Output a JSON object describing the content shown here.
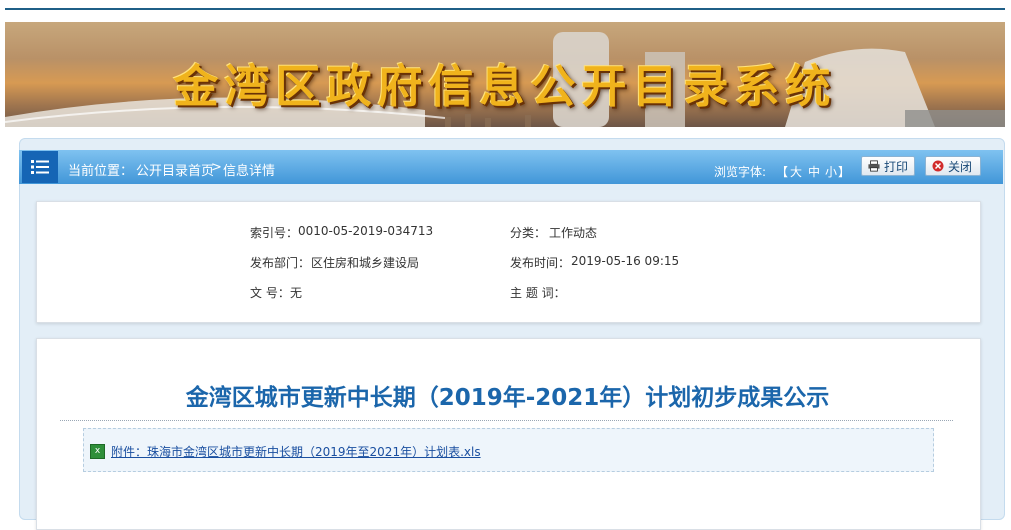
{
  "banner": {
    "title": "金湾区政府信息公开目录系统"
  },
  "nav": {
    "location_label": "当前位置：",
    "breadcrumb_home": "公开目录首页",
    "breadcrumb_sep": ">",
    "breadcrumb_current": "信息详情",
    "font_label": "浏览字体:",
    "font_open": "【",
    "font_large": "大",
    "font_medium": "中",
    "font_small": "小",
    "font_close": "】",
    "print_label": "打印",
    "close_label": "关闭"
  },
  "meta": {
    "index_label": "索引号：",
    "index_value": "0010-05-2019-034713",
    "category_label": "分类：",
    "category_value": "工作动态",
    "dept_label": "发布部门：",
    "dept_value": "区住房和城乡建设局",
    "time_label": "发布时间：",
    "time_value": "2019-05-16 09:15",
    "docno_label": "文 号：",
    "docno_value": "无",
    "keyword_label": "主 题 词："
  },
  "article": {
    "title": "金湾区城市更新中长期（2019年-2021年）计划初步成果公示",
    "attachment": "附件：珠海市金湾区城市更新中长期（2019年至2021年）计划表.xls"
  },
  "colors": {
    "nav_blue": "#4196d8",
    "title_blue": "#1b66ab",
    "banner_gold": "#f0b31c"
  }
}
